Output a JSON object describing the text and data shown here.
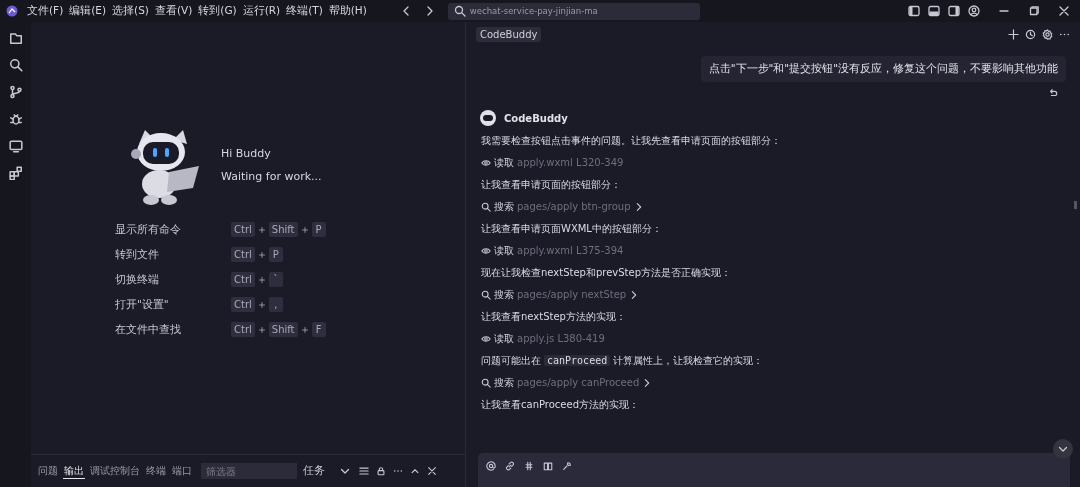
{
  "menu": [
    "文件(F)",
    "编辑(E)",
    "选择(S)",
    "查看(V)",
    "转到(G)",
    "运行(R)",
    "终端(T)",
    "帮助(H)"
  ],
  "search": {
    "value": "wechat-service-pay-jinjian-ma"
  },
  "welcome": {
    "greeting": "Hi Buddy",
    "status": "Waiting for work...",
    "shortcuts": [
      {
        "label": "显示所有命令",
        "keys": [
          "Ctrl",
          "Shift",
          "P"
        ]
      },
      {
        "label": "转到文件",
        "keys": [
          "Ctrl",
          "P"
        ]
      },
      {
        "label": "切换终端",
        "keys": [
          "Ctrl",
          "`"
        ]
      },
      {
        "label": "打开\"设置\"",
        "keys": [
          "Ctrl",
          ","
        ]
      },
      {
        "label": "在文件中查找",
        "keys": [
          "Ctrl",
          "Shift",
          "F"
        ]
      }
    ]
  },
  "panel": {
    "tabs": [
      {
        "label": "问题",
        "selected": false
      },
      {
        "label": "输出",
        "selected": true
      },
      {
        "label": "调试控制台",
        "selected": false
      },
      {
        "label": "终端",
        "selected": false
      },
      {
        "label": "端口",
        "selected": false
      }
    ],
    "filter": {
      "placeholder": "筛选器"
    },
    "dropdown": "任务"
  },
  "chat": {
    "tab": "CodeBuddy",
    "user_message": "点击\"下一步\"和\"提交按钮\"没有反应，修复这个问题，不要影响其他功能",
    "assistant": "CodeBuddy",
    "steps": [
      {
        "kind": "text",
        "parts": [
          {
            "text": "我需要检查按钮点击事件的问题。让我先查看申请页面的按钮部分：",
            "code": false
          }
        ]
      },
      {
        "kind": "read",
        "action": "读取",
        "target": "apply.wxml L320-349"
      },
      {
        "kind": "text",
        "parts": [
          {
            "text": "让我查看申请页面的按钮部分：",
            "code": false
          }
        ]
      },
      {
        "kind": "search",
        "action": "搜索",
        "target": "pages/apply btn-group"
      },
      {
        "kind": "text",
        "parts": [
          {
            "text": "让我查看申请页面WXML中的按钮部分：",
            "code": false
          }
        ]
      },
      {
        "kind": "read",
        "action": "读取",
        "target": "apply.wxml L375-394"
      },
      {
        "kind": "text",
        "parts": [
          {
            "text": "现在让我检查nextStep和prevStep方法是否正确实现：",
            "code": false
          }
        ]
      },
      {
        "kind": "search",
        "action": "搜索",
        "target": "pages/apply nextStep"
      },
      {
        "kind": "text",
        "parts": [
          {
            "text": "让我查看nextStep方法的实现：",
            "code": false
          }
        ]
      },
      {
        "kind": "read",
        "action": "读取",
        "target": "apply.js L380-419"
      },
      {
        "kind": "text",
        "parts": [
          {
            "text": "问题可能出在",
            "code": false
          },
          {
            "text": "canProceed",
            "code": true
          },
          {
            "text": "计算属性上，让我检查它的实现：",
            "code": false
          }
        ]
      },
      {
        "kind": "search",
        "action": "搜索",
        "target": "pages/apply canProceed"
      },
      {
        "kind": "text",
        "parts": [
          {
            "text": "让我查看canProceed方法的实现：",
            "code": false
          }
        ]
      }
    ]
  }
}
